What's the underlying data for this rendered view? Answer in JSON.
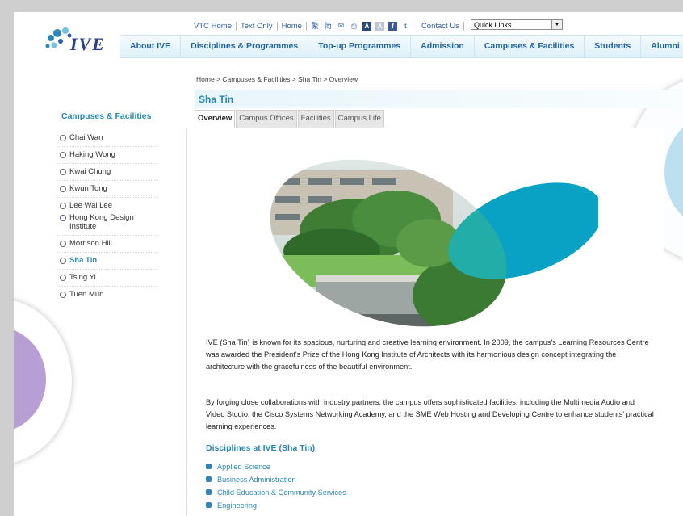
{
  "logo": {
    "text": "IVE"
  },
  "utility": {
    "links": [
      "VTC Home",
      "Text Only",
      "Home"
    ],
    "icons": [
      "traditional-chinese-icon",
      "simplified-chinese-icon",
      "email-icon",
      "print-icon",
      "font-large-icon",
      "font-small-icon",
      "facebook-icon",
      "twitter-icon"
    ],
    "icon_glyphs": [
      "繁",
      "简",
      "✉",
      "⎙",
      "A",
      "A",
      "f",
      "t"
    ],
    "contact": "Contact Us",
    "quick_links": "Quick Links"
  },
  "nav": {
    "items": [
      "About IVE",
      "Disciplines & Programmes",
      "Top-up Programmes",
      "Admission",
      "Campuses & Facilities",
      "Students",
      "Alumni"
    ]
  },
  "breadcrumb": "Home > Campuses & Facilities > Sha Tin > Overview",
  "sidebar": {
    "title": "Campuses & Facilities",
    "items": [
      "Chai Wan",
      "Haking Wong",
      "Kwai Chung",
      "Kwun Tong",
      "Lee Wai Lee",
      "Hong Kong Design Institute",
      "Morrison Hill",
      "Sha Tin",
      "Tsing Yi",
      "Tuen Mun"
    ],
    "active": "Sha Tin"
  },
  "main": {
    "title": "Sha Tin",
    "tabs": [
      "Overview",
      "Campus Offices",
      "Facilities",
      "Campus Life"
    ],
    "active_tab": "Overview",
    "paragraph1": "IVE (Sha Tin) is known for its spacious, nurturing and creative learning environment. In 2009, the campus's Learning Resources Centre was awarded the President's Prize of the Hong Kong Institute of Architects with its harmonious design concept integrating the architecture with the gracefulness of the beautiful environment.",
    "paragraph2": "By forging close collaborations with industry partners, the campus offers sophisticated facilities, including the Multimedia Audio and Video Studio, the Cisco Systems Networking Academy, and the SME Web Hosting and Developing Centre to enhance students' practical learning experiences.",
    "disciplines_title": "Disciplines at IVE (Sha Tin)",
    "disciplines": [
      "Applied Science",
      "Business Administration",
      "Child Education & Community Services",
      "Engineering"
    ]
  },
  "colors": {
    "accent": "#2a86b8",
    "nav_text": "#1f63a8",
    "hero_teal": "#0aa2c4",
    "deco_purple": "#b79fd3",
    "deco_blue": "#bde0f0"
  }
}
